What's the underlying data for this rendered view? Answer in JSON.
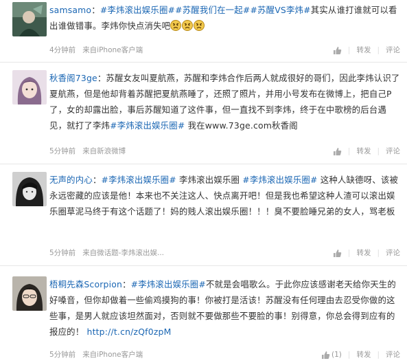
{
  "posts": [
    {
      "user": "samsamo",
      "segments": [
        {
          "kind": "user",
          "text": "samsamo"
        },
        {
          "kind": "text",
          "text": "："
        },
        {
          "kind": "tag",
          "text": "#李炜滚出娱乐圈#"
        },
        {
          "kind": "tag",
          "text": "#苏醒我们在一起#"
        },
        {
          "kind": "tag",
          "text": "#苏醒VS李炜#"
        },
        {
          "kind": "text",
          "text": "其实从谁打谁就可以看出谁做错事。李炜你快点消失吧"
        }
      ],
      "emoji_icons": [
        "angry-face-icon",
        "angry-face-icon",
        "angry-face-icon"
      ],
      "time": "4分钟前",
      "source": "来自iPhone客户端",
      "actions": {
        "like_count": "",
        "repost": "转发",
        "comment": "评论"
      }
    },
    {
      "user": "秋香阁73ge",
      "segments": [
        {
          "kind": "user",
          "text": "秋香阁73ge"
        },
        {
          "kind": "text",
          "text": "：苏醒女友叫夏航燕，苏醒和李炜合作后两人就成很好的哥们，因此李炜认识了夏航燕，但是他却背着苏醒把夏航燕睡了，还照了照片，并用小号发布在微博上，把自己P了，女的却露出脸，事后苏醒知道了这件事，但一直找不到李炜，终于在中歌榜的后台遇见，就打了李炜"
        },
        {
          "kind": "tag",
          "text": "#李炜滚出娱乐圈#"
        },
        {
          "kind": "text",
          "text": " 我在www.73ge.com秋香阁"
        }
      ],
      "time": "5分钟前",
      "source": "来自新浪微博",
      "actions": {
        "like_count": "",
        "repost": "转发",
        "comment": "评论"
      }
    },
    {
      "user": "无声的内心",
      "segments": [
        {
          "kind": "user",
          "text": "无声的内心"
        },
        {
          "kind": "text",
          "text": "："
        },
        {
          "kind": "tag",
          "text": "#李炜滚出娱乐圈#"
        },
        {
          "kind": "text",
          "text": " 李炜滚出娱乐圈 "
        },
        {
          "kind": "tag",
          "text": "#李炜滚出娱乐圈#"
        },
        {
          "kind": "text",
          "text": " 这种人缺德呀、该被永远密藏的应该是他！本来也不关注这人、快点离开吧！但是我也希望这种人渣可以滚出娱乐圈草泥马终于有这个话题了！妈的贱人滚出娱乐圈！！！臭不要脸睡兄弟的女人，骂老板"
        }
      ],
      "time": "5分钟前",
      "source": "来自微话题-李炜滚出娱...",
      "actions": {
        "like_count": "",
        "repost": "转发",
        "comment": "评论"
      }
    },
    {
      "user": "梧桐先森Scorpion",
      "segments": [
        {
          "kind": "user",
          "text": "梧桐先森Scorpion"
        },
        {
          "kind": "text",
          "text": "："
        },
        {
          "kind": "tag",
          "text": "#李炜滚出娱乐圈#"
        },
        {
          "kind": "text",
          "text": "不就是会唱歌么。于此你应该感谢老天给你天生的好嗓音，但你却做着一些偷鸡摸狗的事！你被打是活该！苏醒没有任何理由去忍受你做的这些事，是男人就应该坦然面对，否则就不要做那些不要脸的事！别得意，你总会得到应有的报应的！ "
        },
        {
          "kind": "link",
          "text": "http://t.cn/zQf0zpM"
        }
      ],
      "time": "5分钟前",
      "source": "来自iPhone客户端",
      "actions": {
        "like_count": "(1)",
        "repost": "转发",
        "comment": "评论"
      }
    }
  ]
}
